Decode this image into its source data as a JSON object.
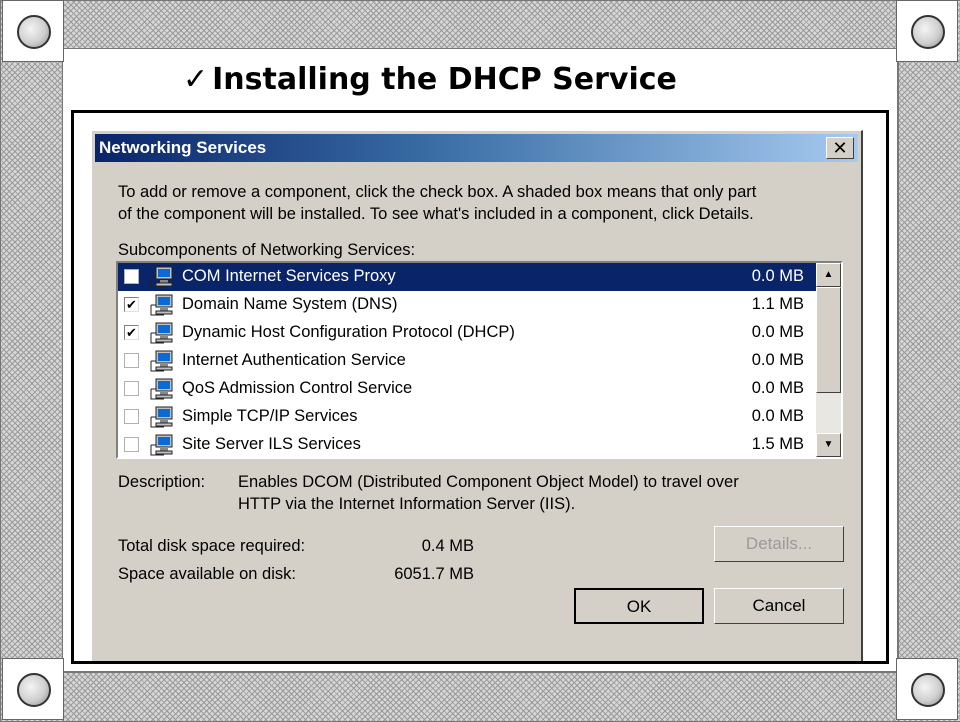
{
  "slide": {
    "checkmark": "✓",
    "title": "Installing the DHCP Service"
  },
  "dialog": {
    "title": "Networking Services",
    "close_glyph": "✕",
    "instructions_line1": "To add or remove a component, click the check box. A shaded box means that only part",
    "instructions_line2": "of the component will be installed. To see what's included in a component, click Details.",
    "list_label": "Subcomponents of Networking Services:",
    "items": [
      {
        "label": "COM Internet Services Proxy",
        "size": "0.0 MB",
        "checked": "",
        "selected": true,
        "icon": "network-computer-icon"
      },
      {
        "label": "Domain Name System (DNS)",
        "size": "1.1 MB",
        "checked": "✔",
        "selected": false,
        "icon": "network-computer-icon"
      },
      {
        "label": "Dynamic Host Configuration Protocol (DHCP)",
        "size": "0.0 MB",
        "checked": "✔",
        "selected": false,
        "icon": "network-computer-icon"
      },
      {
        "label": "Internet Authentication Service",
        "size": "0.0 MB",
        "checked": "",
        "selected": false,
        "icon": "network-computer-icon"
      },
      {
        "label": "QoS Admission Control Service",
        "size": "0.0 MB",
        "checked": "",
        "selected": false,
        "icon": "network-computer-icon"
      },
      {
        "label": "Simple TCP/IP Services",
        "size": "0.0 MB",
        "checked": "",
        "selected": false,
        "icon": "network-computer-icon"
      },
      {
        "label": "Site Server ILS Services",
        "size": "1.5 MB",
        "checked": "",
        "selected": false,
        "icon": "network-computer-icon"
      }
    ],
    "description_label": "Description:",
    "description_line1": "Enables DCOM (Distributed Component Object Model) to travel over",
    "description_line2": "HTTP via the Internet Information Server (IIS).",
    "total_label": "Total disk space required:",
    "total_value": "0.4 MB",
    "available_label": "Space available on disk:",
    "available_value": "6051.7 MB",
    "details_label": "Details...",
    "ok_label": "OK",
    "cancel_label": "Cancel",
    "scroll_up_glyph": "▲",
    "scroll_down_glyph": "▼"
  },
  "colors": {
    "selection": "#0a246a",
    "dialog_bg": "#d4d0c8",
    "title_start": "#0a246a",
    "title_end": "#a6caf0"
  }
}
